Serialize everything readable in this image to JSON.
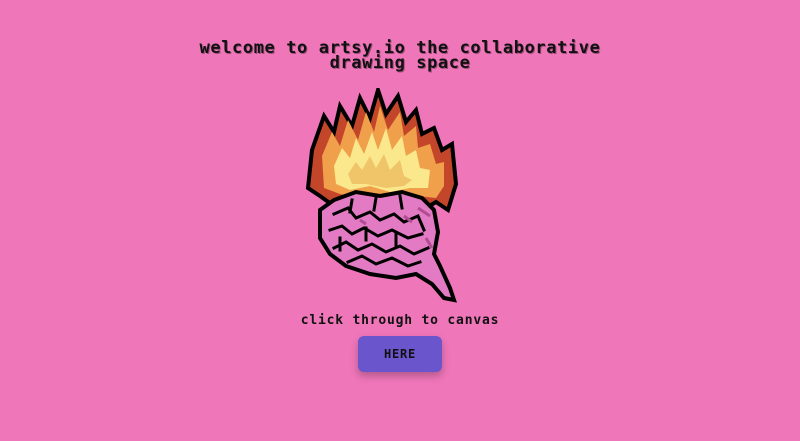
{
  "page": {
    "title_line1": "welcome to artsy.io the collaborative",
    "title_line2": "drawing space",
    "prompt": "click through to canvas",
    "button_label": "HERE"
  },
  "colors": {
    "background": "#ef76b9",
    "button": "#6a55cc",
    "text": "#111111",
    "flame_dark": "#c4462a",
    "flame_mid": "#f0a04a",
    "flame_light": "#fbe88c",
    "brain": "#e27bc4"
  },
  "icons": {
    "hero": "flaming-brain-icon"
  }
}
